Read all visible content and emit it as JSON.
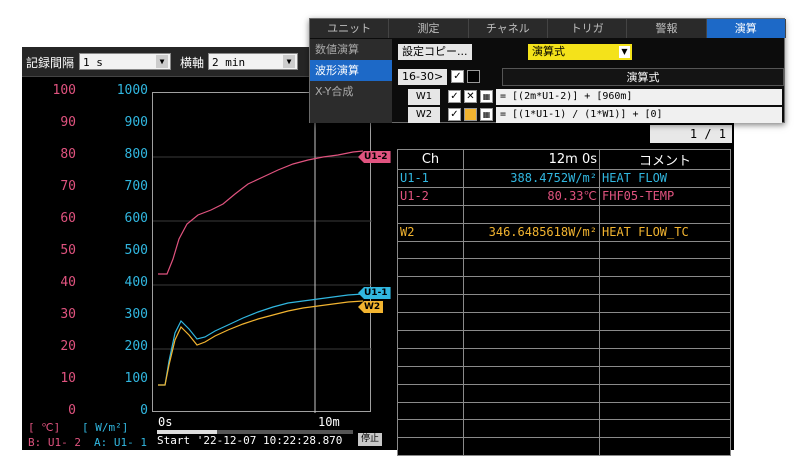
{
  "toolbar": {
    "interval_label": "記録間隔",
    "interval_value": "1 s",
    "timebase_label": "横軸",
    "timebase_value": "2 min"
  },
  "axes": {
    "b_ticks": [
      "100",
      "90",
      "80",
      "70",
      "60",
      "50",
      "40",
      "30",
      "20",
      "10",
      "0"
    ],
    "a_ticks": [
      "1000",
      "900",
      "800",
      "700",
      "600",
      "500",
      "400",
      "300",
      "200",
      "100",
      "0"
    ],
    "b_unit": "[  ℃]",
    "a_unit": "[  W/m²]",
    "b_assign": "B:  U1- 2",
    "a_assign": "A:  U1- 1",
    "time_start": "0s",
    "time_end": "10m"
  },
  "plot_tags": {
    "u12": "U1-2",
    "u11": "U1-1",
    "w2": "W2"
  },
  "start_text": "Start '22-12-07 10:22:28.870",
  "stop_label": "停止",
  "page_indicator": "1 / 1",
  "table": {
    "headers": [
      "Ch",
      "12m 0s",
      "コメント"
    ],
    "rows": [
      {
        "ch": "U1-1",
        "value": "388.4752W/m²",
        "comment": "HEAT FLOW"
      },
      {
        "ch": "U1-2",
        "value": "80.33℃",
        "comment": "FHF05-TEMP"
      },
      {
        "ch": "",
        "value": "",
        "comment": ""
      },
      {
        "ch": "W2",
        "value": "346.6485618W/m²",
        "comment": "HEAT FLOW_TC"
      }
    ]
  },
  "popup": {
    "tabs": [
      "ユニット",
      "測定",
      "チャネル",
      "トリガ",
      "警報",
      "演算"
    ],
    "sidebar": [
      "数値演算",
      "波形演算",
      "X-Y合成"
    ],
    "copy_button": "設定コピー...",
    "formula_select": "演算式",
    "range_button": "16-30>",
    "expr_header": "演算式",
    "rows": [
      {
        "label": "W1",
        "expr": "= [(2m*U1-2)] + [960m]"
      },
      {
        "label": "W2",
        "expr": "= [(1*U1-1) / (1*W1)] + [0]"
      }
    ]
  },
  "colors": {
    "u11": "#31b7e0",
    "u12": "#e0537f",
    "w2": "#f2b430",
    "active_tab": "#1d69c7"
  }
}
